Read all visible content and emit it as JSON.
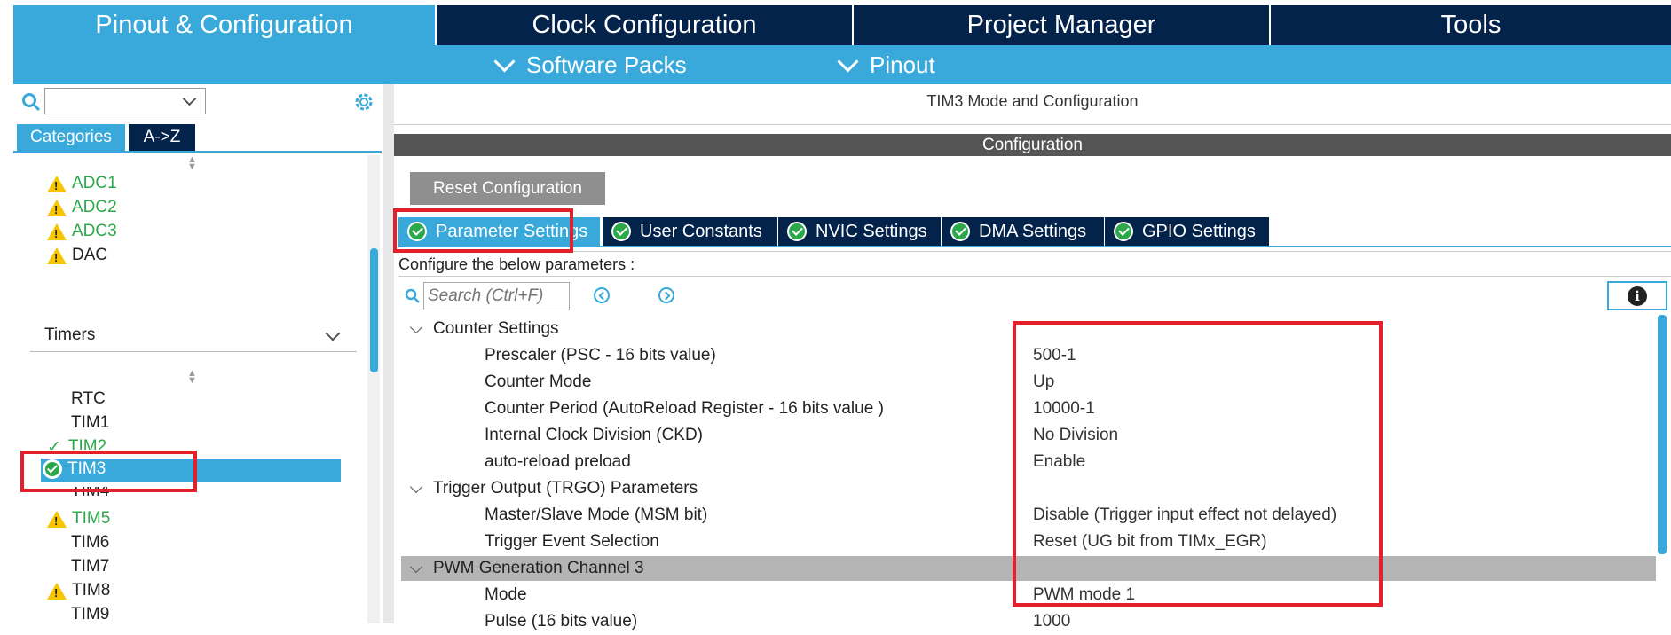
{
  "top_tabs": [
    "Pinout & Configuration",
    "Clock Configuration",
    "Project Manager",
    "Tools"
  ],
  "sub_menu": [
    "Software Packs",
    "Pinout"
  ],
  "left": {
    "category_tabs": [
      "Categories",
      "A->Z"
    ],
    "analog_items": [
      "ADC1",
      "ADC2",
      "ADC3",
      "DAC"
    ],
    "timers_header": "Timers",
    "timer_items": [
      "RTC",
      "TIM1",
      "TIM2",
      "TIM3",
      "TIM4",
      "TIM5",
      "TIM6",
      "TIM7",
      "TIM8",
      "TIM9"
    ]
  },
  "right": {
    "title": "TIM3 Mode and Configuration",
    "config_header": "Configuration",
    "reset_button": "Reset Configuration",
    "tabs": [
      "Parameter Settings",
      "User Constants",
      "NVIC Settings",
      "DMA Settings",
      "GPIO Settings"
    ],
    "hint": "Configure the below parameters :",
    "search_placeholder": "Search (Ctrl+F)",
    "groups": {
      "counter": "Counter Settings",
      "trgo": "Trigger Output (TRGO) Parameters",
      "pwm": "PWM Generation Channel 3"
    },
    "params": [
      {
        "name": "Prescaler (PSC - 16 bits value)",
        "value": "500-1"
      },
      {
        "name": "Counter Mode",
        "value": "Up"
      },
      {
        "name": "Counter Period (AutoReload Register - 16 bits value )",
        "value": "10000-1"
      },
      {
        "name": "Internal Clock Division (CKD)",
        "value": "No Division"
      },
      {
        "name": "auto-reload preload",
        "value": "Enable"
      },
      {
        "name": "Master/Slave Mode (MSM bit)",
        "value": "Disable (Trigger input effect not delayed)"
      },
      {
        "name": "Trigger Event Selection",
        "value": "Reset (UG bit from TIMx_EGR)"
      },
      {
        "name": "Mode",
        "value": "PWM mode 1"
      },
      {
        "name": "Pulse (16 bits value)",
        "value": "1000"
      }
    ]
  },
  "colors": {
    "accent": "#39a9dc",
    "dark": "#03234b",
    "highlight": "#e5202a",
    "ok": "#2ba84a",
    "warn": "#f7c600"
  }
}
